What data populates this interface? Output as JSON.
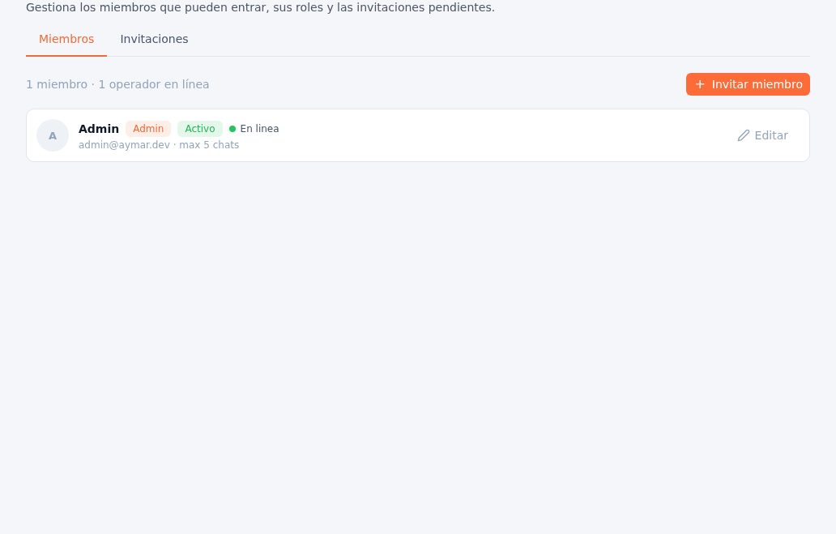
{
  "description": "Gestiona los miembros que pueden entrar, sus roles y las invitaciones pendientes.",
  "tabs": [
    {
      "label": "Miembros",
      "selected": true
    },
    {
      "label": "Invitaciones",
      "selected": false
    }
  ],
  "summary": "1 miembro · 1 operador en línea",
  "invite_button": {
    "icon": "+",
    "label": "Invitar miembro"
  },
  "members": [
    {
      "initial": "A",
      "name": "Admin",
      "badges": [
        {
          "kind": "role",
          "text": "Admin"
        },
        {
          "kind": "status",
          "text": "Activo"
        }
      ],
      "online": true,
      "presence": "En linea",
      "details": "admin@aymar.dev · max 5 chats",
      "edit_label": "Editar"
    }
  ]
}
